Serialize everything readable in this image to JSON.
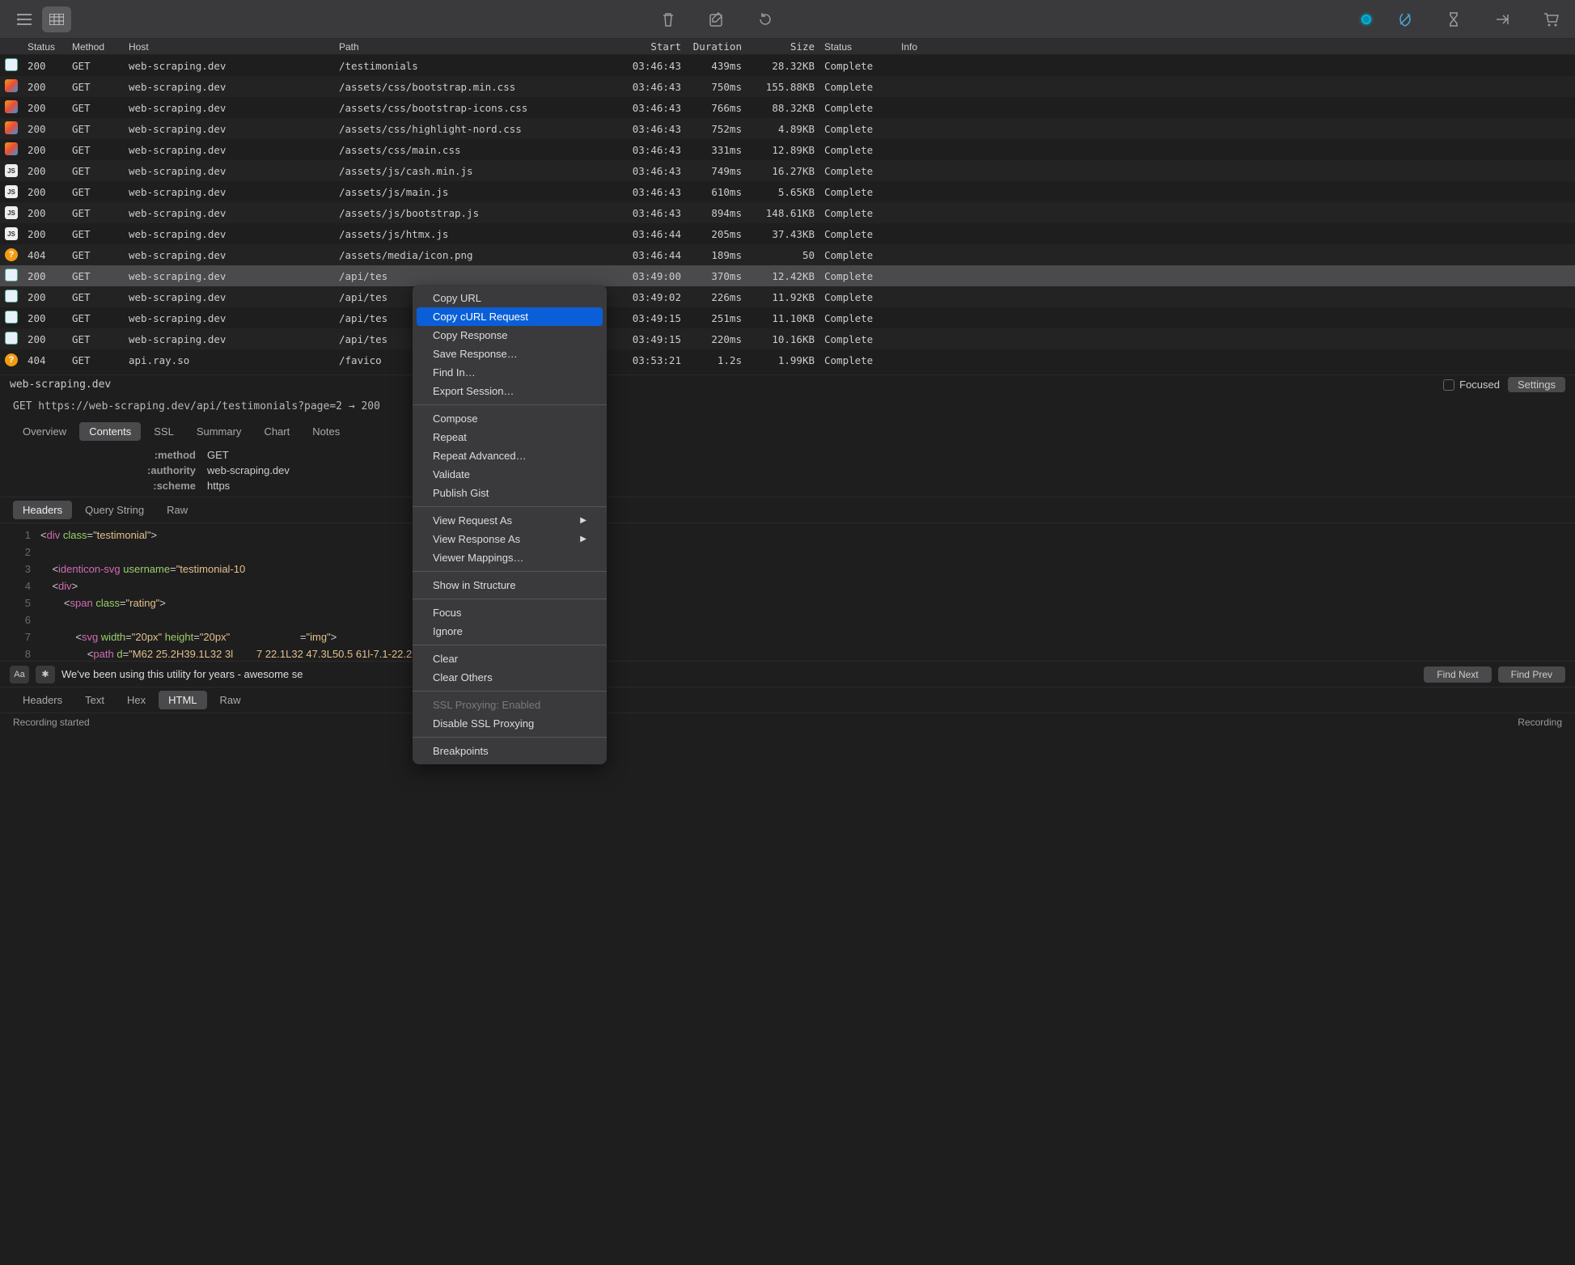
{
  "toolbar": {},
  "columns": {
    "status": "Status",
    "method": "Method",
    "host": "Host",
    "path": "Path",
    "start": "Start",
    "duration": "Duration",
    "size": "Size",
    "rstatus": "Status",
    "info": "Info"
  },
  "rows": [
    {
      "icon": "doc",
      "st": "200",
      "m": "GET",
      "h": "web-scraping.dev",
      "p": "/testimonials",
      "start": "03:46:43",
      "dur": "439ms",
      "size": "28.32KB",
      "rs": "Complete"
    },
    {
      "icon": "css",
      "st": "200",
      "m": "GET",
      "h": "web-scraping.dev",
      "p": "/assets/css/bootstrap.min.css",
      "start": "03:46:43",
      "dur": "750ms",
      "size": "155.88KB",
      "rs": "Complete"
    },
    {
      "icon": "css",
      "st": "200",
      "m": "GET",
      "h": "web-scraping.dev",
      "p": "/assets/css/bootstrap-icons.css",
      "start": "03:46:43",
      "dur": "766ms",
      "size": "88.32KB",
      "rs": "Complete"
    },
    {
      "icon": "css",
      "st": "200",
      "m": "GET",
      "h": "web-scraping.dev",
      "p": "/assets/css/highlight-nord.css",
      "start": "03:46:43",
      "dur": "752ms",
      "size": "4.89KB",
      "rs": "Complete"
    },
    {
      "icon": "css",
      "st": "200",
      "m": "GET",
      "h": "web-scraping.dev",
      "p": "/assets/css/main.css",
      "start": "03:46:43",
      "dur": "331ms",
      "size": "12.89KB",
      "rs": "Complete"
    },
    {
      "icon": "js",
      "st": "200",
      "m": "GET",
      "h": "web-scraping.dev",
      "p": "/assets/js/cash.min.js",
      "start": "03:46:43",
      "dur": "749ms",
      "size": "16.27KB",
      "rs": "Complete"
    },
    {
      "icon": "js",
      "st": "200",
      "m": "GET",
      "h": "web-scraping.dev",
      "p": "/assets/js/main.js",
      "start": "03:46:43",
      "dur": "610ms",
      "size": "5.65KB",
      "rs": "Complete"
    },
    {
      "icon": "js",
      "st": "200",
      "m": "GET",
      "h": "web-scraping.dev",
      "p": "/assets/js/bootstrap.js",
      "start": "03:46:43",
      "dur": "894ms",
      "size": "148.61KB",
      "rs": "Complete"
    },
    {
      "icon": "js",
      "st": "200",
      "m": "GET",
      "h": "web-scraping.dev",
      "p": "/assets/js/htmx.js",
      "start": "03:46:44",
      "dur": "205ms",
      "size": "37.43KB",
      "rs": "Complete"
    },
    {
      "icon": "warn",
      "st": "404",
      "m": "GET",
      "h": "web-scraping.dev",
      "p": "/assets/media/icon.png",
      "start": "03:46:44",
      "dur": "189ms",
      "size": "50",
      "rs": "Complete"
    },
    {
      "icon": "doc",
      "st": "200",
      "m": "GET",
      "h": "web-scraping.dev",
      "p": "/api/tes",
      "start": "03:49:00",
      "dur": "370ms",
      "size": "12.42KB",
      "rs": "Complete",
      "selected": true
    },
    {
      "icon": "doc",
      "st": "200",
      "m": "GET",
      "h": "web-scraping.dev",
      "p": "/api/tes",
      "start": "03:49:02",
      "dur": "226ms",
      "size": "11.92KB",
      "rs": "Complete"
    },
    {
      "icon": "doc",
      "st": "200",
      "m": "GET",
      "h": "web-scraping.dev",
      "p": "/api/tes",
      "start": "03:49:15",
      "dur": "251ms",
      "size": "11.10KB",
      "rs": "Complete"
    },
    {
      "icon": "doc",
      "st": "200",
      "m": "GET",
      "h": "web-scraping.dev",
      "p": "/api/tes",
      "start": "03:49:15",
      "dur": "220ms",
      "size": "10.16KB",
      "rs": "Complete"
    },
    {
      "icon": "warn",
      "st": "404",
      "m": "GET",
      "h": "api.ray.so",
      "p": "/favico",
      "start": "03:53:21",
      "dur": "1.2s",
      "size": "1.99KB",
      "rs": "Complete"
    }
  ],
  "detail": {
    "host": "web-scraping.dev",
    "focused_label": "Focused",
    "settings_label": "Settings",
    "request_line": "GET https://web-scraping.dev/api/testimonials?page=2  →  200"
  },
  "main_tabs": [
    "Overview",
    "Contents",
    "SSL",
    "Summary",
    "Chart",
    "Notes"
  ],
  "main_tab_active": 1,
  "kv": [
    {
      "k": ":method",
      "v": "GET"
    },
    {
      "k": ":authority",
      "v": "web-scraping.dev"
    },
    {
      "k": ":scheme",
      "v": "https"
    }
  ],
  "subtabs": [
    "Headers",
    "Query String",
    "Raw"
  ],
  "subtab_active": 0,
  "code_lines": [
    [
      {
        "t": "punct",
        "x": "<"
      },
      {
        "t": "tagname",
        "x": "div"
      },
      {
        "t": "punct",
        "x": " "
      },
      {
        "t": "attrname",
        "x": "class"
      },
      {
        "t": "punct",
        "x": "="
      },
      {
        "t": "attrval",
        "x": "\"testimonial\""
      },
      {
        "t": "punct",
        "x": ">"
      }
    ],
    [],
    [
      {
        "t": "punct",
        "x": "    <"
      },
      {
        "t": "tagname",
        "x": "identicon-svg"
      },
      {
        "t": "punct",
        "x": " "
      },
      {
        "t": "attrname",
        "x": "username"
      },
      {
        "t": "punct",
        "x": "="
      },
      {
        "t": "attrval",
        "x": "\"testimonial-10"
      }
    ],
    [
      {
        "t": "punct",
        "x": "    <"
      },
      {
        "t": "tagname",
        "x": "div"
      },
      {
        "t": "punct",
        "x": ">"
      }
    ],
    [
      {
        "t": "punct",
        "x": "        <"
      },
      {
        "t": "tagname",
        "x": "span"
      },
      {
        "t": "punct",
        "x": " "
      },
      {
        "t": "attrname",
        "x": "class"
      },
      {
        "t": "punct",
        "x": "="
      },
      {
        "t": "attrval",
        "x": "\"rating\""
      },
      {
        "t": "punct",
        "x": ">"
      }
    ],
    [],
    [
      {
        "t": "punct",
        "x": "            <"
      },
      {
        "t": "tagname",
        "x": "svg"
      },
      {
        "t": "punct",
        "x": " "
      },
      {
        "t": "attrname",
        "x": "width"
      },
      {
        "t": "punct",
        "x": "="
      },
      {
        "t": "attrval",
        "x": "\"20px\""
      },
      {
        "t": "punct",
        "x": " "
      },
      {
        "t": "attrname",
        "x": "height"
      },
      {
        "t": "punct",
        "x": "="
      },
      {
        "t": "attrval",
        "x": "\"20px\""
      },
      {
        "t": "punct",
        "x": "                        ="
      },
      {
        "t": "attrval",
        "x": "\"img\""
      },
      {
        "t": "punct",
        "x": ">"
      }
    ],
    [
      {
        "t": "punct",
        "x": "                <"
      },
      {
        "t": "tagname",
        "x": "path"
      },
      {
        "t": "punct",
        "x": " "
      },
      {
        "t": "attrname",
        "x": "d"
      },
      {
        "t": "punct",
        "x": "="
      },
      {
        "t": "attrval",
        "x": "\"M62 25.2H39.1L32 3l        7 22.1L32 47.3L50.5 61l-7.1-22.2L62 25.2z\""
      }
    ]
  ],
  "find": {
    "aa": "Aa",
    "regex": "✱",
    "text": "We've been using this utility for years - awesome se",
    "next": "Find Next",
    "prev": "Find Prev"
  },
  "bottom_tabs": [
    "Headers",
    "Text",
    "Hex",
    "HTML",
    "Raw"
  ],
  "bottom_tab_active": 3,
  "status_left": "Recording started",
  "status_right": "Recording",
  "context_menu": [
    {
      "label": "Copy URL"
    },
    {
      "label": "Copy cURL Request",
      "hl": true
    },
    {
      "label": "Copy Response"
    },
    {
      "label": "Save Response…"
    },
    {
      "label": "Find In…"
    },
    {
      "label": "Export Session…"
    },
    {
      "sep": true
    },
    {
      "label": "Compose"
    },
    {
      "label": "Repeat"
    },
    {
      "label": "Repeat Advanced…"
    },
    {
      "label": "Validate"
    },
    {
      "label": "Publish Gist"
    },
    {
      "sep": true
    },
    {
      "label": "View Request As",
      "arrow": true
    },
    {
      "label": "View Response As",
      "arrow": true
    },
    {
      "label": "Viewer Mappings…"
    },
    {
      "sep": true
    },
    {
      "label": "Show in Structure"
    },
    {
      "sep": true
    },
    {
      "label": "Focus"
    },
    {
      "label": "Ignore"
    },
    {
      "sep": true
    },
    {
      "label": "Clear"
    },
    {
      "label": "Clear Others"
    },
    {
      "sep": true
    },
    {
      "label": "SSL Proxying: Enabled",
      "disabled": true
    },
    {
      "label": "Disable SSL Proxying"
    },
    {
      "sep": true
    },
    {
      "label": "Breakpoints"
    }
  ]
}
